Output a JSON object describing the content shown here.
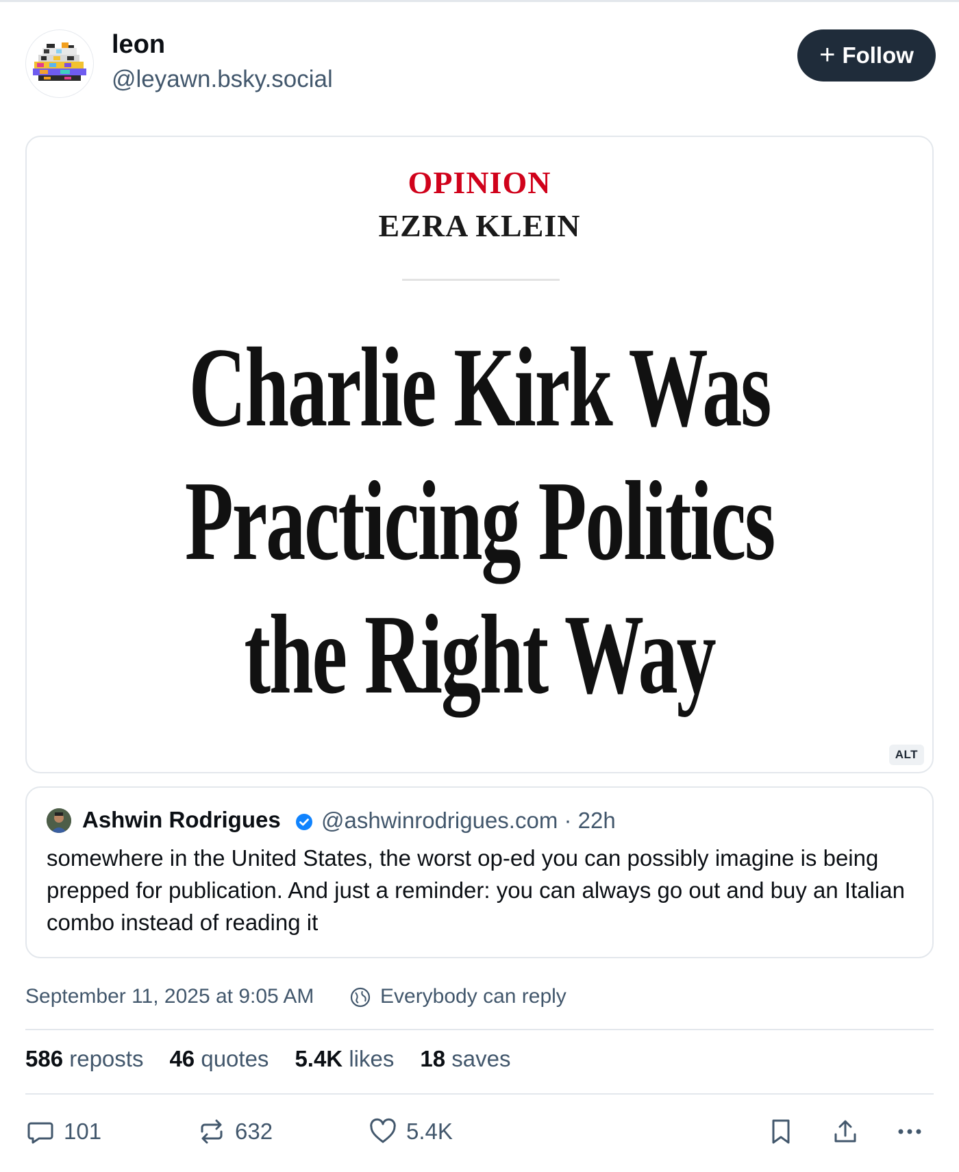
{
  "author": {
    "display_name": "leon",
    "handle": "@leyawn.bsky.social",
    "follow_label": "Follow"
  },
  "image": {
    "kicker": "OPINION",
    "byline": "EZRA KLEIN",
    "headline_lines": [
      "Charlie Kirk Was",
      "Practicing Politics",
      "the Right Way"
    ],
    "alt_badge": "ALT"
  },
  "quote": {
    "name": "Ashwin Rodrigues",
    "handle_time": "@ashwinrodrigues.com · 22h",
    "text": "somewhere in the United States, the worst op-ed you can possibly imagine is being prepped for publication. And just a reminder: you can always go out and buy an Italian combo instead of reading it"
  },
  "meta": {
    "timestamp": "September 11, 2025 at 9:05 AM",
    "reply_setting": "Everybody can reply"
  },
  "stats": {
    "reposts_count": "586",
    "reposts_label": "reposts",
    "quotes_count": "46",
    "quotes_label": "quotes",
    "likes_count": "5.4K",
    "likes_label": "likes",
    "saves_count": "18",
    "saves_label": "saves"
  },
  "actions": {
    "replies": "101",
    "reposts": "632",
    "likes": "5.4K"
  },
  "colors": {
    "follow_bg": "#1f2c3a",
    "kicker_red": "#d0021b",
    "verified_blue": "#1083fe",
    "muted_text": "#42576c"
  },
  "icons": [
    "plus-icon",
    "verified-badge-icon",
    "globe-icon",
    "reply-icon",
    "repost-icon",
    "like-icon",
    "bookmark-icon",
    "share-icon",
    "more-icon"
  ]
}
